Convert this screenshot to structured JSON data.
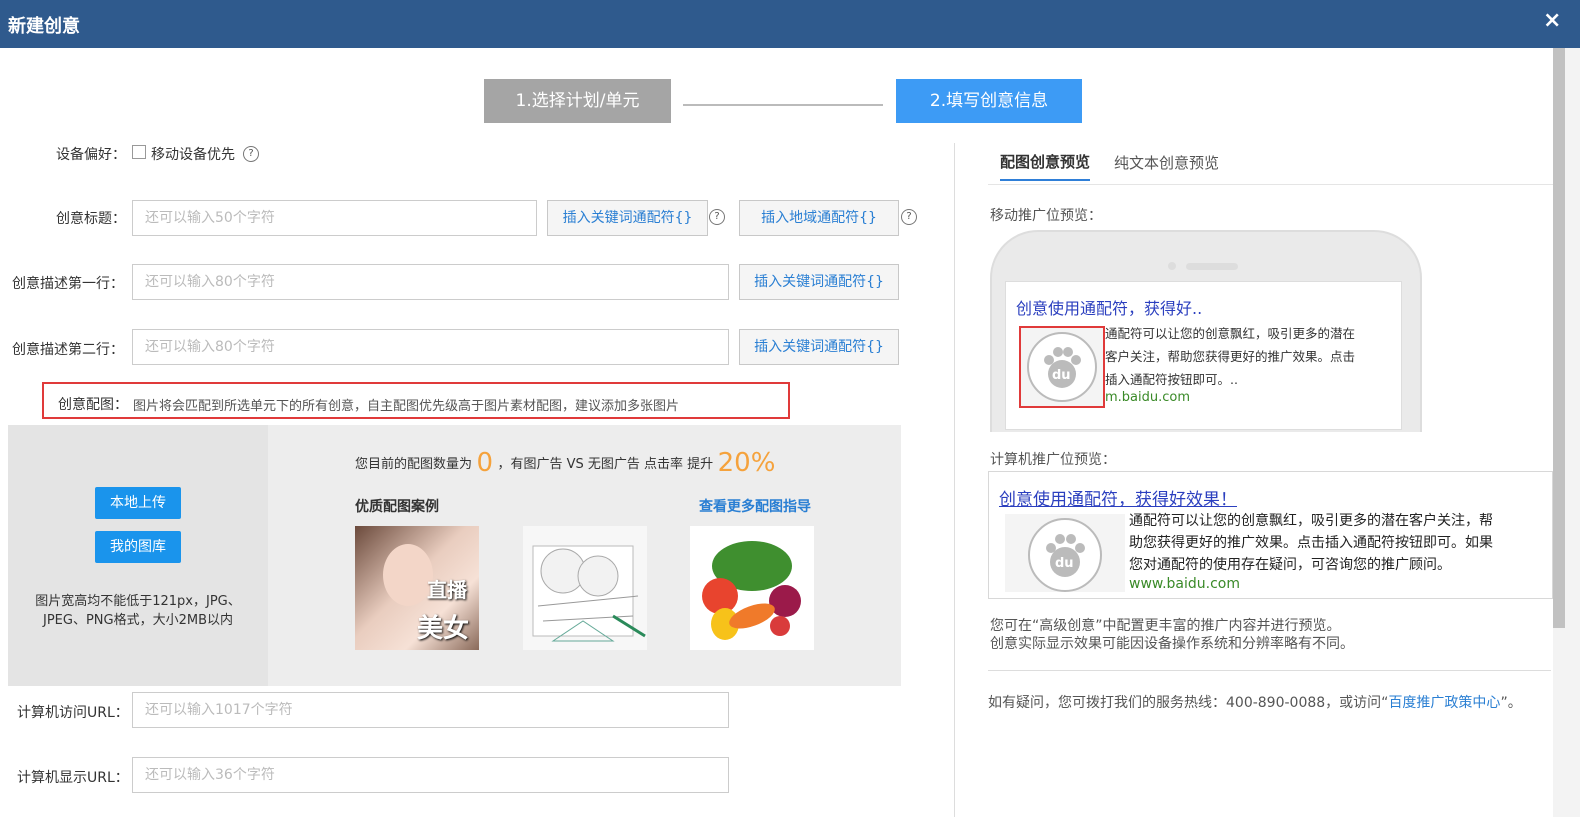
{
  "header": {
    "title": "新建创意",
    "close": "×"
  },
  "steps": {
    "step1": "1.选择计划/单元",
    "step2": "2.填写创意信息"
  },
  "form": {
    "device_label": "设备偏好：",
    "device_option": "移动设备优先",
    "title_label": "创意标题：",
    "title_placeholder": "还可以输入50个字符",
    "insert_keyword_btn": "插入关键词通配符{}",
    "insert_region_btn": "插入地域通配符{}",
    "desc1_label": "创意描述第一行：",
    "desc1_placeholder": "还可以输入80个字符",
    "desc2_label": "创意描述第二行：",
    "desc2_placeholder": "还可以输入80个字符",
    "image_label": "创意配图：",
    "image_hint": "图片将会匹配到所选单元下的所有创意，自主配图优先级高于图片素材配图，建议添加多张图片",
    "pc_url_label": "计算机访问URL：",
    "pc_url_placeholder": "还可以输入1017个字符",
    "pc_display_label": "计算机显示URL：",
    "pc_display_placeholder": "还可以输入36个字符"
  },
  "image_section": {
    "upload_btn": "本地上传",
    "gallery_btn": "我的图库",
    "requirement_line1": "图片宽高均不能低于121px，JPG、",
    "requirement_line2": "JPEG、PNG格式，大小2MB以内",
    "stat_prefix": "您目前的配图数量为",
    "stat_count": "0",
    "stat_middle": "，有图广告 VS 无图广告 点击率 提升",
    "stat_percent": "20%",
    "examples_title": "优质配图案例",
    "more_link": "查看更多配图指导",
    "example1_text1": "直播",
    "example1_text2": "美女"
  },
  "preview": {
    "tab_image": "配图创意预览",
    "tab_text": "纯文本创意预览",
    "mobile_label": "移动推广位预览：",
    "mobile_title": "创意使用通配符，获得好..",
    "mobile_desc1": "通配符可以让您的创意飘红，吸引更多的潜在",
    "mobile_desc2": "客户关注，帮助您获得更好的推广效果。点击",
    "mobile_desc3": "插入通配符按钮即可。..",
    "mobile_url": "m.baidu.com",
    "logo_text": "du",
    "pc_label": "计算机推广位预览：",
    "pc_title": "创意使用通配符，获得好效果！",
    "pc_desc1": "通配符可以让您的创意飘红，吸引更多的潜在客户关注，帮",
    "pc_desc2": "助您获得更好的推广效果。点击插入通配符按钮即可。如果",
    "pc_desc3": "您对通配符的使用存在疑问，可咨询您的推广顾问。",
    "pc_url": "www.baidu.com",
    "note1": "您可在“高级创意”中配置更丰富的推广内容并进行预览。",
    "note2": "创意实际显示效果可能因设备操作系统和分辨率略有不同。",
    "help_prefix": "如有疑问，您可拨打我们的服务热线：400-890-0088，或访问“",
    "help_link": "百度推广政策中心",
    "help_suffix": "”。"
  },
  "colors": {
    "header": "#2f5a8d",
    "accent": "#3d9bf5",
    "orange": "#f5a23c",
    "highlight": "#e03a3a",
    "green": "#3a8a28"
  }
}
